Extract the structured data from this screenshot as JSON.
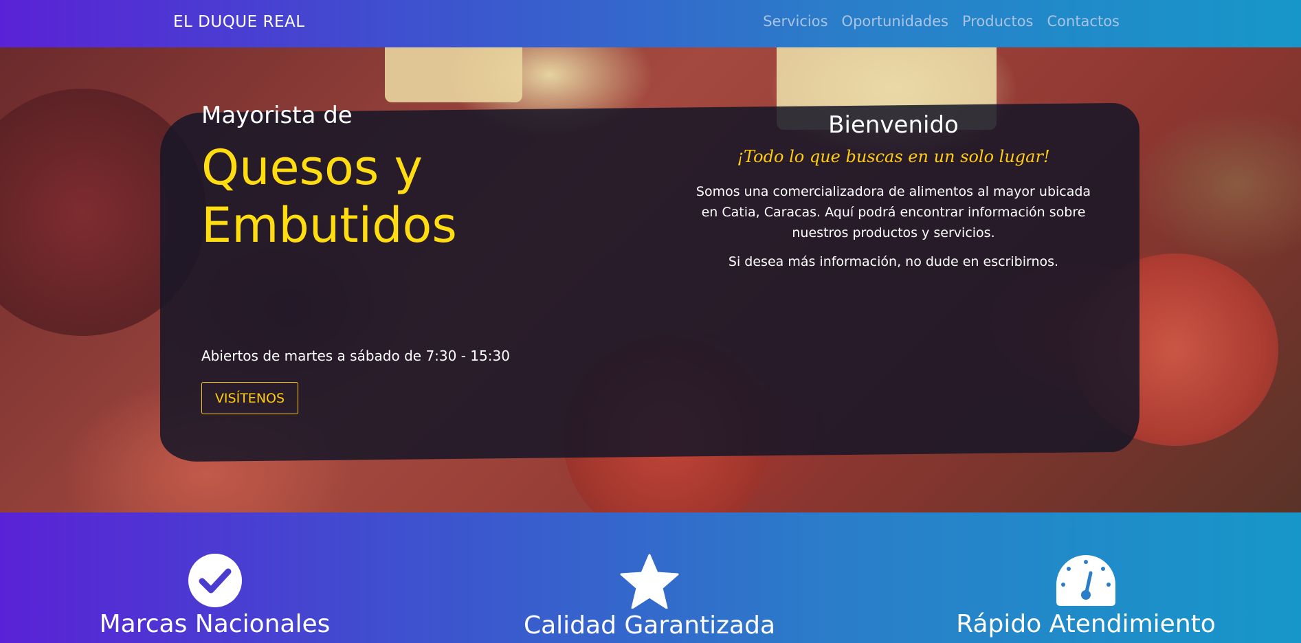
{
  "navbar": {
    "brand": "EL DUQUE REAL",
    "links": [
      "Servicios",
      "Oportunidades",
      "Productos",
      "Contactos"
    ]
  },
  "hero": {
    "subtitle": "Mayorista de",
    "title_line1": "Quesos y",
    "title_line2": "Embutidos",
    "hours": "Abiertos de martes a sábado de 7:30 - 15:30",
    "cta": "VISÍTENOS",
    "welcome": "Bienvenido",
    "tagline": "¡Todo lo que buscas en un solo lugar!",
    "description": "Somos una comercializadora de alimentos al mayor ubicada en Catia, Caracas. Aquí podrá encontrar información sobre nuestros productos y servicios.",
    "contact_note": "Si desea más información, no dude en escribirnos."
  },
  "features": [
    {
      "icon": "check-circle-icon",
      "label": "Marcas Nacionales"
    },
    {
      "icon": "star-icon",
      "label": "Calidad Garantizada"
    },
    {
      "icon": "speedometer-icon",
      "label": "Rápido Atendimiento"
    }
  ],
  "colors": {
    "accent_yellow": "#ffdd11",
    "gradient_start": "#5a22d6",
    "gradient_end": "#1797c9",
    "nav_link": "#a9c4e6"
  }
}
